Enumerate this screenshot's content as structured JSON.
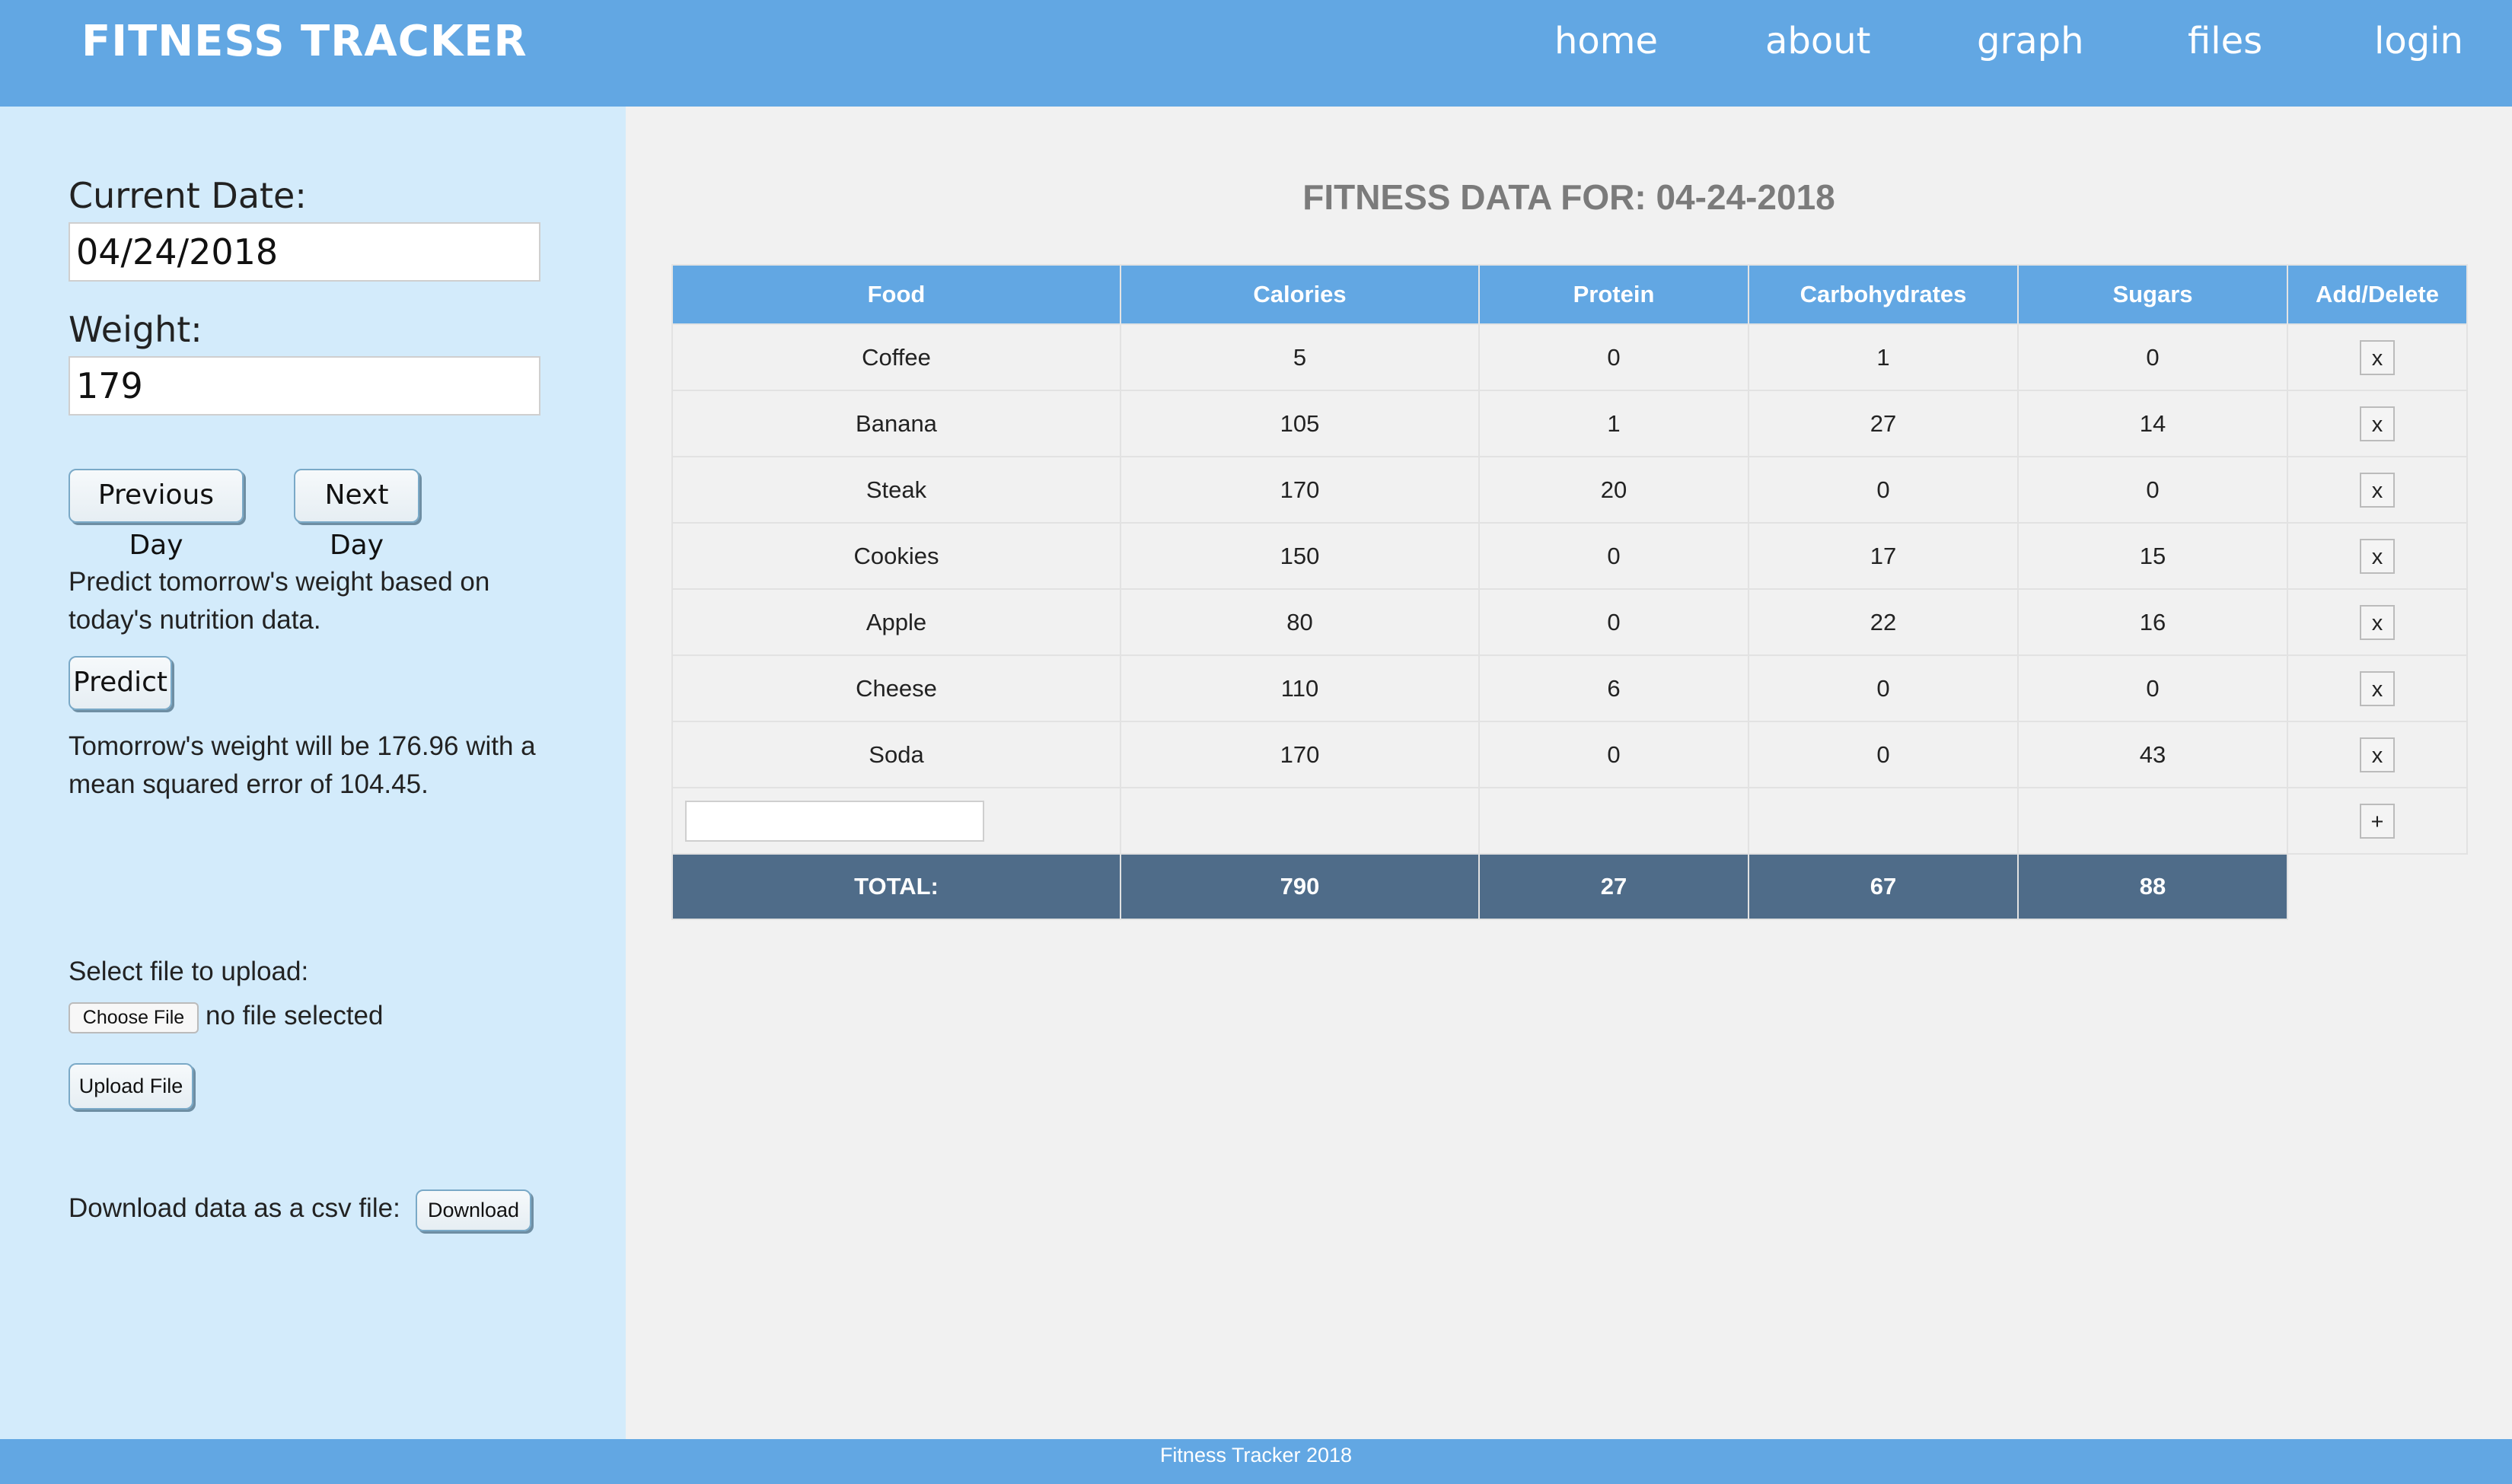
{
  "header": {
    "brand": "FITNESS TRACKER",
    "nav": [
      "home",
      "about",
      "graph",
      "files",
      "login"
    ]
  },
  "sidebar": {
    "current_date_label": "Current Date:",
    "current_date_value": "04/24/2018",
    "weight_label": "Weight:",
    "weight_value": "179",
    "previous_day": "Previous Day",
    "next_day": "Next Day",
    "predict_text_line1": "Predict tomorrow's weight based on",
    "predict_text_line2": "today's nutrition data.",
    "predict_button": "Predict",
    "result_line1": "Tomorrow's weight will be 176.96 with a",
    "result_line2": "mean squared error of 104.45.",
    "upload_label": "Select file to upload:",
    "choose_file": "Choose File",
    "no_file": "no file selected",
    "upload_button": "Upload File",
    "download_label": "Download data as a csv file:",
    "download_button": "Download"
  },
  "main": {
    "title": "FITNESS DATA FOR: 04-24-2018",
    "columns": [
      "Food",
      "Calories",
      "Protein",
      "Carbohydrates",
      "Sugars",
      "Add/Delete"
    ],
    "rows": [
      [
        "Coffee",
        "5",
        "0",
        "1",
        "0"
      ],
      [
        "Banana",
        "105",
        "1",
        "27",
        "14"
      ],
      [
        "Steak",
        "170",
        "20",
        "0",
        "0"
      ],
      [
        "Cookies",
        "150",
        "0",
        "17",
        "15"
      ],
      [
        "Apple",
        "80",
        "0",
        "22",
        "16"
      ],
      [
        "Cheese",
        "110",
        "6",
        "0",
        "0"
      ],
      [
        "Soda",
        "170",
        "0",
        "0",
        "43"
      ]
    ],
    "delete_label": "x",
    "add_label": "+",
    "new_food_value": "",
    "totals": [
      "TOTAL:",
      "790",
      "27",
      "67",
      "88"
    ]
  },
  "footer": {
    "text": "Fitness Tracker 2018"
  },
  "colors": {
    "header": "#62a7e3",
    "sidebar": "#d3ebfb",
    "total_row": "#4f6c89",
    "title": "#7b7b7b"
  }
}
